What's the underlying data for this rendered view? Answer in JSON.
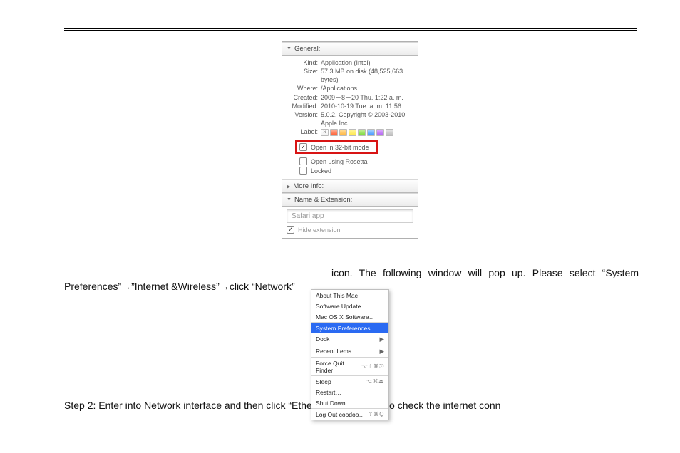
{
  "info_panel": {
    "general": {
      "title": "General:",
      "kind_label": "Kind:",
      "kind": "Application (Intel)",
      "size_label": "Size:",
      "size": "57.3 MB on disk (48,525,663 bytes)",
      "where_label": "Where:",
      "where": "/Applications",
      "created_label": "Created:",
      "created": "2009－8－20 Thu. 1:22 a. m.",
      "modified_label": "Modified:",
      "modified": "2010-10-19 Tue. a. m. 11:56",
      "version_label": "Version:",
      "version": "5.0.2, Copyright © 2003-2010 Apple Inc.",
      "label_label": "Label:",
      "open32": "Open in 32-bit mode",
      "rosetta": "Open using Rosetta",
      "locked": "Locked"
    },
    "more_info": "More Info:",
    "name_ext": {
      "title": "Name & Extension:",
      "value": "Safari.app",
      "hide_ext": "Hide extension"
    }
  },
  "text": {
    "line1": "icon. The following window will pop up. Please select “System",
    "line2": "Preferences”→”Internet &Wireless”→click “Network”",
    "line3": "Step 2: Enter into Network interface and then click “Ethernet Connected” to check the internet conn"
  },
  "menu": {
    "about": "About This Mac",
    "update": "Software Update…",
    "macosx": "Mac OS X Software…",
    "sysprefs": "System Preferences…",
    "dock": "Dock",
    "recent": "Recent Items",
    "forcequit": "Force Quit Finder",
    "forcequit_sc": "⌥⇧⌘⎋",
    "sleep": "Sleep",
    "sleep_sc": "⌥⌘⏏",
    "restart": "Restart…",
    "shutdown": "Shut Down…",
    "logout": "Log Out coodoo…",
    "logout_sc": "⇧⌘Q"
  }
}
